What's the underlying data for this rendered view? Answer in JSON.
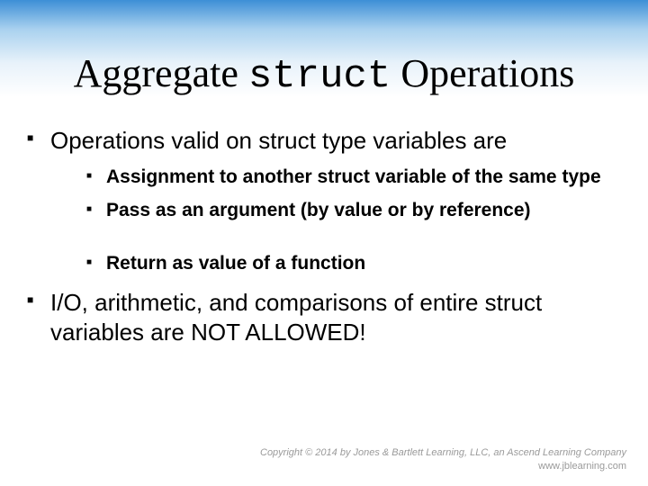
{
  "title": {
    "pre": "Aggregate ",
    "code": "struct",
    "post": " Operations"
  },
  "bullets": {
    "b1": "Operations valid on struct type variables are",
    "b1_sub": {
      "s1": "Assignment to another struct variable of the same type",
      "s2": "Pass as an argument  (by value or by reference)",
      "s3": "Return as value of a function"
    },
    "b2": "I/O, arithmetic, and comparisons of entire struct variables are NOT ALLOWED!"
  },
  "footer": {
    "line1": "Copyright © 2014 by Jones & Bartlett Learning, LLC, an Ascend Learning Company",
    "line2": "www.jblearning.com"
  }
}
